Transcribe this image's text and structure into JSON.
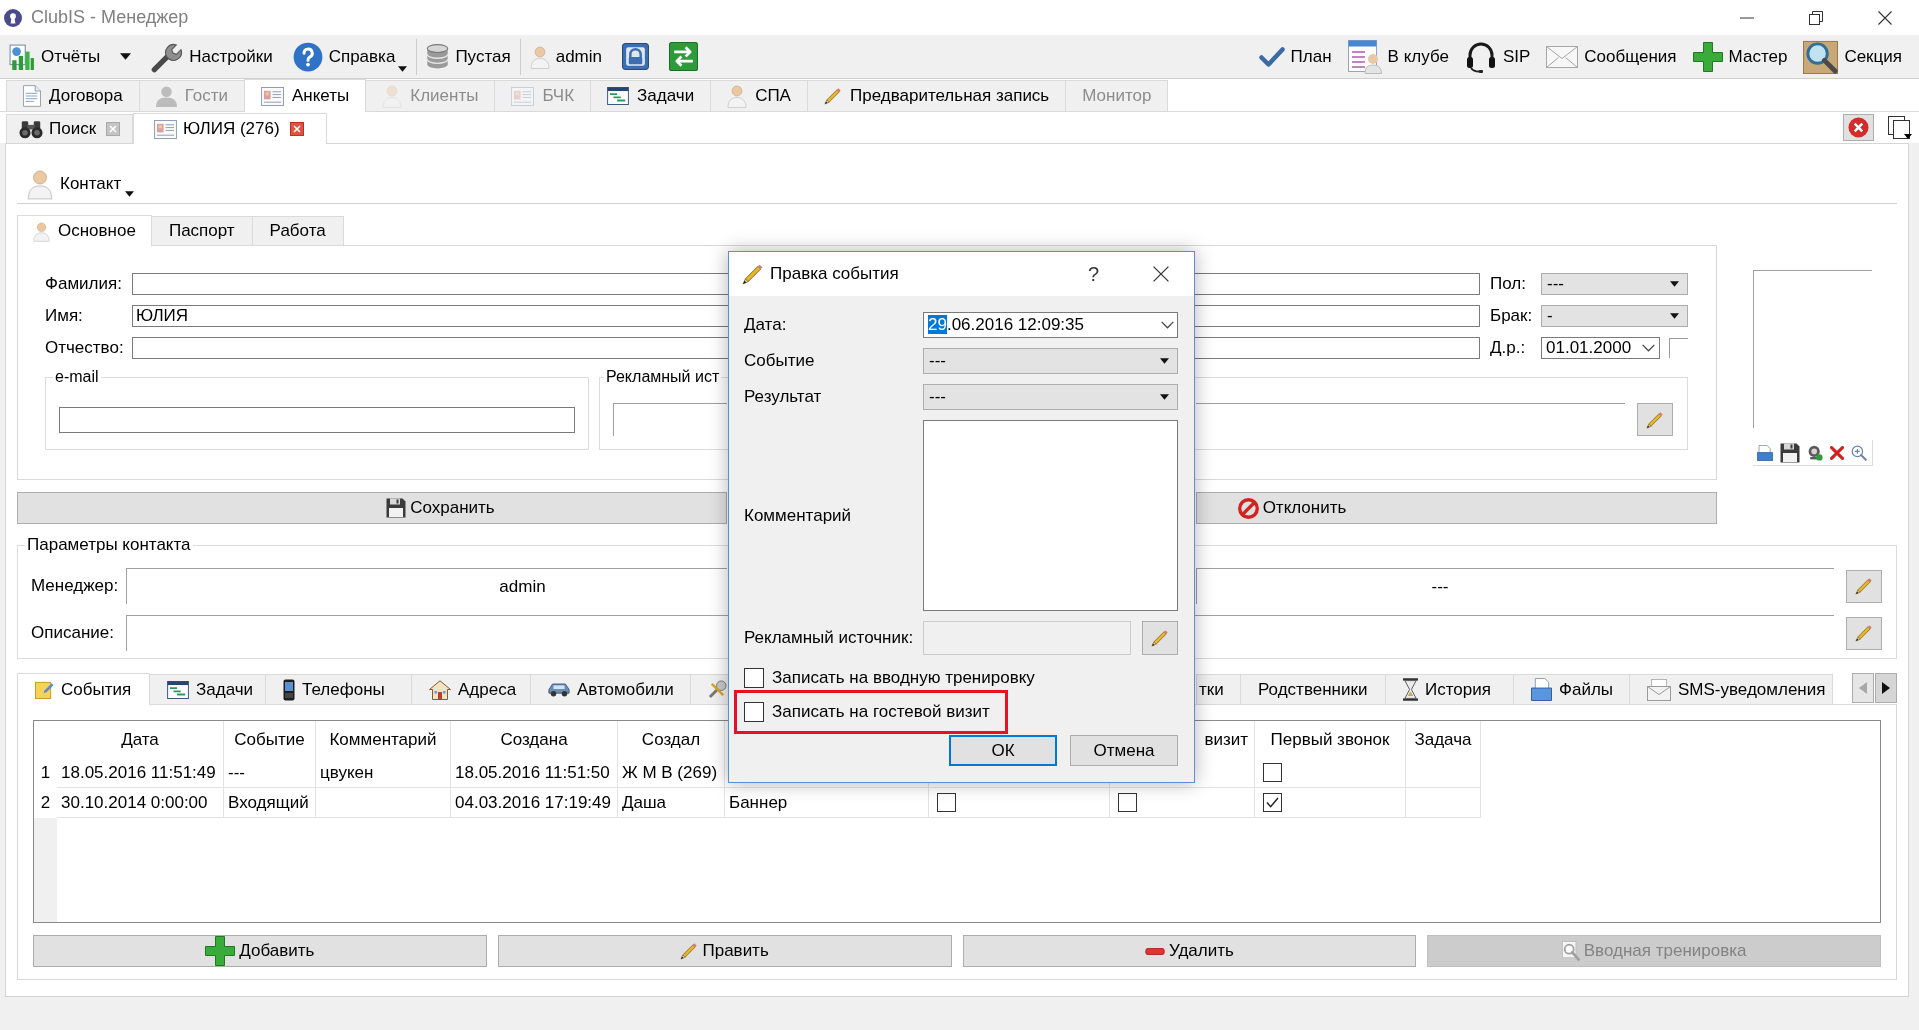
{
  "window": {
    "title": "ClubIS - Менеджер"
  },
  "toolbar": {
    "groups": [
      [
        {
          "kind": "split",
          "label": "Отчёты"
        },
        {
          "kind": "plain",
          "label": "Настройки"
        },
        {
          "kind": "menu",
          "label": "Справка"
        }
      ],
      [
        {
          "kind": "plain",
          "label": "Пустая"
        }
      ],
      [
        {
          "kind": "plain",
          "label": "admin"
        },
        {
          "kind": "icon"
        },
        {
          "kind": "icon"
        }
      ]
    ],
    "right": [
      {
        "label": "План"
      },
      {
        "label": "В клубе"
      },
      {
        "label": "SIP"
      },
      {
        "label": "Сообщения"
      },
      {
        "label": "Мастер"
      },
      {
        "label": "Секция"
      }
    ]
  },
  "main_tabs": [
    {
      "label": "Договора",
      "selected": false,
      "disabled": false
    },
    {
      "label": "Гости",
      "selected": false,
      "disabled": true
    },
    {
      "label": "Анкеты",
      "selected": true,
      "disabled": false
    },
    {
      "label": "Клиенты",
      "selected": false,
      "disabled": true
    },
    {
      "label": "БЧК",
      "selected": false,
      "disabled": true
    },
    {
      "label": "Задачи",
      "selected": false,
      "disabled": false
    },
    {
      "label": "СПА",
      "selected": false,
      "disabled": false
    },
    {
      "label": "Предварительная запись",
      "selected": false,
      "disabled": false
    },
    {
      "label": "Монитор",
      "selected": false,
      "disabled": true
    }
  ],
  "doc_tabs": [
    {
      "label": "Поиск",
      "selected": false
    },
    {
      "label": "ЮЛИЯ (276)",
      "selected": true
    }
  ],
  "contact": {
    "label": "Контакт"
  },
  "form": {
    "tabs": [
      {
        "label": "Основное",
        "selected": true
      },
      {
        "label": "Паспорт",
        "selected": false
      },
      {
        "label": "Работа",
        "selected": false
      }
    ],
    "fields": [
      {
        "label": "Фамилия:",
        "side": {
          "kind": "combo",
          "label": "Пол:",
          "value": "---"
        }
      },
      {
        "label": "Имя:",
        "value": "ЮЛИЯ",
        "side": {
          "kind": "combo",
          "label": "Брак:",
          "value": "-"
        }
      },
      {
        "label": "Отчество:",
        "side": {
          "kind": "date",
          "label": "Д.р.:",
          "value": "01.01.2000"
        }
      }
    ],
    "email_group": {
      "title": "e-mail"
    },
    "ad_group": {
      "title": "Рекламный ист"
    },
    "buttons": [
      {
        "label": "Сохранить"
      },
      {
        "label": "Отклонить"
      }
    ]
  },
  "params": {
    "title": "Параметры контакта",
    "rows": [
      {
        "label": "Менеджер:",
        "values": [
          "admin",
          "---"
        ]
      },
      {
        "label": "Описание:"
      }
    ]
  },
  "bottom_tabs": {
    "tabs": [
      {
        "label": "События",
        "selected": true
      },
      {
        "label": "Задачи",
        "selected": false
      },
      {
        "label": "Телефоны",
        "selected": false
      },
      {
        "label": "Адреса",
        "selected": false
      },
      {
        "label": "Автомобили",
        "selected": false
      },
      {
        "selected": false
      },
      {
        "label": "тки",
        "selected": false
      },
      {
        "label": "Родственники",
        "selected": false
      },
      {
        "label": "История",
        "selected": false
      },
      {
        "label": "Файлы",
        "selected": false
      },
      {
        "label": "SMS-уведомления",
        "selected": false
      }
    ],
    "scroll_buttons": [
      {
        "disabled": true
      },
      {
        "disabled": false
      }
    ]
  },
  "table": {
    "columns": [
      {
        "label": "Дата"
      },
      {
        "label": "Событие"
      },
      {
        "label": "Комментарий"
      },
      {
        "label": "Создана"
      },
      {
        "label": "Создал"
      },
      {},
      {},
      {
        "label": "визит"
      },
      {
        "label": "Первый звонок"
      },
      {
        "label": "Задача"
      }
    ],
    "rows": [
      {
        "number": "1",
        "cells": [
          {
            "kind": "text",
            "text": "18.05.2016 11:51:49"
          },
          {
            "kind": "text",
            "text": "---"
          },
          {
            "kind": "text",
            "text": "цвукен"
          },
          {
            "kind": "text",
            "text": "18.05.2016 11:51:50"
          },
          {
            "kind": "text",
            "text": "Ж М В (269)"
          },
          {
            "kind": "covered"
          },
          {
            "kind": "covered"
          },
          {
            "kind": "blank"
          },
          {
            "kind": "check",
            "checked": false
          },
          {
            "kind": "blank"
          }
        ]
      },
      {
        "number": "2",
        "cells": [
          {
            "kind": "text",
            "text": "30.10.2014 0:00:00"
          },
          {
            "kind": "text",
            "text": "Входящий"
          },
          {
            "kind": "blank"
          },
          {
            "kind": "text",
            "text": "04.03.2016 17:19:49"
          },
          {
            "kind": "text",
            "text": "Даша"
          },
          {
            "kind": "text",
            "text": "Баннер"
          },
          {
            "kind": "check",
            "checked": false
          },
          {
            "kind": "check",
            "checked": false
          },
          {
            "kind": "check",
            "checked": true
          },
          {
            "kind": "blank"
          }
        ]
      }
    ]
  },
  "bottom_buttons": [
    {
      "label": "Добавить",
      "disabled": false
    },
    {
      "label": "Править",
      "disabled": false
    },
    {
      "label": "Удалить",
      "disabled": false
    },
    {
      "label": "Вводная тренировка",
      "disabled": true
    }
  ],
  "dialog": {
    "title": "Правка события",
    "help": "?",
    "fields": [
      {
        "kind": "date",
        "label": "Дата:",
        "value_parts": [
          {
            "text": "29",
            "selected": true
          },
          {
            "text": ".06.2016 12:09:35",
            "selected": false
          }
        ]
      },
      {
        "kind": "combo",
        "label": "Событие",
        "value": "---"
      },
      {
        "kind": "combo",
        "label": "Результат",
        "value": "---"
      },
      {
        "kind": "textarea",
        "label": "Комментарий"
      },
      {
        "kind": "lookup",
        "label": "Рекламный источник:"
      }
    ],
    "checkboxes": [
      {
        "label": "Записать на вводную тренировку",
        "checked": false,
        "highlighted": false
      },
      {
        "label": "Записать на гостевой визит",
        "checked": false,
        "highlighted": true
      }
    ],
    "buttons": [
      {
        "label": "ОК",
        "default": true
      },
      {
        "label": "Отмена",
        "default": false
      }
    ]
  }
}
